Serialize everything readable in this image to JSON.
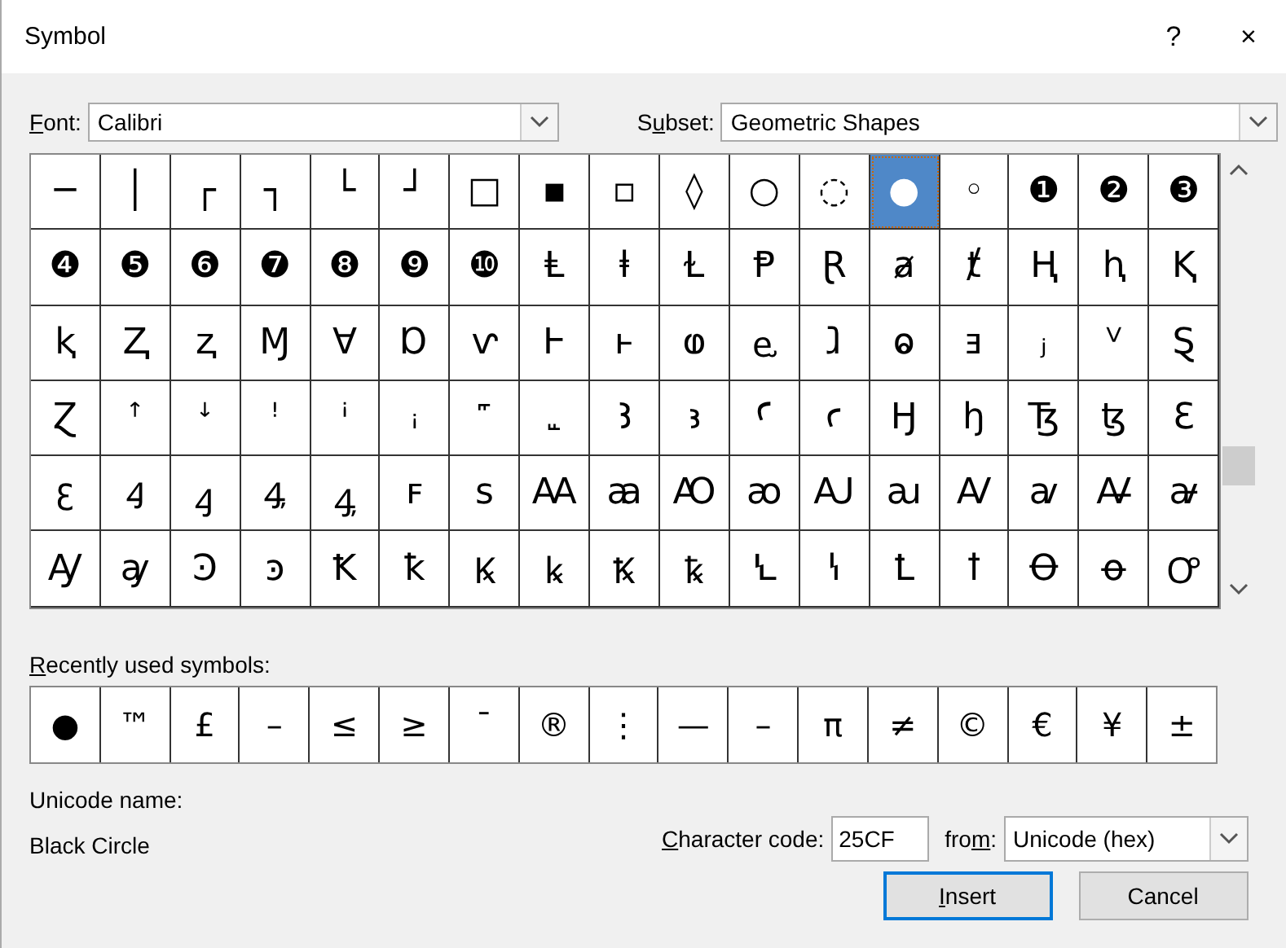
{
  "window": {
    "title": "Symbol",
    "help": "?",
    "close": "×"
  },
  "font": {
    "label": {
      "key": "F",
      "after": "ont:"
    },
    "value": "Calibri"
  },
  "subset": {
    "label": {
      "before": "S",
      "key": "u",
      "after": "bset:"
    },
    "value": "Geometric Shapes"
  },
  "grid": {
    "rows": [
      [
        {
          "char": "─",
          "selected": false
        },
        {
          "char": "│",
          "selected": false
        },
        {
          "char": "┌",
          "selected": false
        },
        {
          "char": "┐",
          "selected": false
        },
        {
          "char": "└",
          "selected": false
        },
        {
          "char": "┘",
          "selected": false
        },
        {
          "char": "□",
          "selected": false
        },
        {
          "char": "▪",
          "selected": false
        },
        {
          "char": "▫",
          "selected": false
        },
        {
          "char": "◊",
          "selected": false
        },
        {
          "char": "○",
          "selected": false
        },
        {
          "char": "◌",
          "selected": false
        },
        {
          "char": "●",
          "selected": true
        },
        {
          "char": "◦",
          "selected": false
        },
        {
          "char": "❶",
          "selected": false
        },
        {
          "char": "❷",
          "selected": false
        },
        {
          "char": "❸",
          "selected": false
        }
      ],
      [
        {
          "char": "❹",
          "selected": false
        },
        {
          "char": "❺",
          "selected": false
        },
        {
          "char": "❻",
          "selected": false
        },
        {
          "char": "❼",
          "selected": false
        },
        {
          "char": "❽",
          "selected": false
        },
        {
          "char": "❾",
          "selected": false
        },
        {
          "char": "❿",
          "selected": false
        },
        {
          "char": "Ⱡ",
          "selected": false
        },
        {
          "char": "ⱡ",
          "selected": false
        },
        {
          "char": "Ɫ",
          "selected": false
        },
        {
          "char": "Ᵽ",
          "selected": false
        },
        {
          "char": "Ɽ",
          "selected": false
        },
        {
          "char": "ⱥ",
          "selected": false
        },
        {
          "char": "ⱦ",
          "selected": false
        },
        {
          "char": "Ⱨ",
          "selected": false
        },
        {
          "char": "ⱨ",
          "selected": false
        },
        {
          "char": "Ⱪ",
          "selected": false
        }
      ],
      [
        {
          "char": "ⱪ",
          "selected": false
        },
        {
          "char": "Ⱬ",
          "selected": false
        },
        {
          "char": "ⱬ",
          "selected": false
        },
        {
          "char": "Ɱ",
          "selected": false
        },
        {
          "char": "Ɐ",
          "selected": false
        },
        {
          "char": "Ɒ",
          "selected": false
        },
        {
          "char": "ⱱ",
          "selected": false
        },
        {
          "char": "Ⱶ",
          "selected": false
        },
        {
          "char": "ⱶ",
          "selected": false
        },
        {
          "char": "ⱷ",
          "selected": false
        },
        {
          "char": "ⱸ",
          "selected": false
        },
        {
          "char": "ⱹ",
          "selected": false
        },
        {
          "char": "ⱺ",
          "selected": false
        },
        {
          "char": "ⱻ",
          "selected": false
        },
        {
          "char": "ⱼ",
          "selected": false
        },
        {
          "char": "ⱽ",
          "selected": false
        },
        {
          "char": "Ȿ",
          "selected": false
        }
      ],
      [
        {
          "char": "Ɀ",
          "selected": false
        },
        {
          "char": "ꜛ",
          "selected": false
        },
        {
          "char": "ꜜ",
          "selected": false
        },
        {
          "char": "ꜝ",
          "selected": false
        },
        {
          "char": "ꜞ",
          "selected": false
        },
        {
          "char": "ꜟ",
          "selected": false
        },
        {
          "char": "꜠",
          "selected": false
        },
        {
          "char": "꜡",
          "selected": false
        },
        {
          "char": "Ꜣ",
          "selected": false
        },
        {
          "char": "ꜣ",
          "selected": false
        },
        {
          "char": "Ꜥ",
          "selected": false
        },
        {
          "char": "ꜥ",
          "selected": false
        },
        {
          "char": "Ꜧ",
          "selected": false
        },
        {
          "char": "ꜧ",
          "selected": false
        },
        {
          "char": "Ꜩ",
          "selected": false
        },
        {
          "char": "ꜩ",
          "selected": false
        },
        {
          "char": "Ꜫ",
          "selected": false
        }
      ],
      [
        {
          "char": "ꜫ",
          "selected": false
        },
        {
          "char": "Ꜭ",
          "selected": false
        },
        {
          "char": "ꜭ",
          "selected": false
        },
        {
          "char": "Ꜯ",
          "selected": false
        },
        {
          "char": "ꜯ",
          "selected": false
        },
        {
          "char": "ꜰ",
          "selected": false
        },
        {
          "char": "ꜱ",
          "selected": false
        },
        {
          "char": "Ꜳ",
          "selected": false
        },
        {
          "char": "ꜳ",
          "selected": false
        },
        {
          "char": "Ꜵ",
          "selected": false
        },
        {
          "char": "ꜵ",
          "selected": false
        },
        {
          "char": "Ꜷ",
          "selected": false
        },
        {
          "char": "ꜷ",
          "selected": false
        },
        {
          "char": "Ꜹ",
          "selected": false
        },
        {
          "char": "ꜹ",
          "selected": false
        },
        {
          "char": "Ꜻ",
          "selected": false
        },
        {
          "char": "ꜻ",
          "selected": false
        }
      ],
      [
        {
          "char": "Ꜽ",
          "selected": false
        },
        {
          "char": "ꜽ",
          "selected": false
        },
        {
          "char": "Ꜿ",
          "selected": false
        },
        {
          "char": "ꜿ",
          "selected": false
        },
        {
          "char": "Ꝁ",
          "selected": false
        },
        {
          "char": "ꝁ",
          "selected": false
        },
        {
          "char": "Ꝃ",
          "selected": false
        },
        {
          "char": "ꝃ",
          "selected": false
        },
        {
          "char": "Ꝅ",
          "selected": false
        },
        {
          "char": "ꝅ",
          "selected": false
        },
        {
          "char": "Ꝇ",
          "selected": false
        },
        {
          "char": "ꝇ",
          "selected": false
        },
        {
          "char": "Ꝉ",
          "selected": false
        },
        {
          "char": "ꝉ",
          "selected": false
        },
        {
          "char": "Ꝋ",
          "selected": false
        },
        {
          "char": "ꝋ",
          "selected": false
        },
        {
          "char": "Ꝍ",
          "selected": false
        }
      ]
    ]
  },
  "recent": {
    "label": {
      "key": "R",
      "after": "ecently used symbols:"
    },
    "symbols": [
      "●",
      "™",
      "£",
      "–",
      "≤",
      "≥",
      "¯",
      "®",
      "⋮",
      "—",
      "–",
      "π",
      "≠",
      "©",
      "€",
      "¥",
      "±"
    ]
  },
  "unicode_name": {
    "label": "Unicode name:",
    "value": "Black Circle"
  },
  "character_code": {
    "label": {
      "key": "C",
      "after": "haracter code:"
    },
    "value": "25CF"
  },
  "from": {
    "label": {
      "before": "fro",
      "key": "m",
      "after": ":"
    },
    "value": "Unicode (hex)"
  },
  "buttons": [
    {
      "label": {
        "key": "I",
        "after": "nsert"
      },
      "default": true
    },
    {
      "label": {
        "before": "Cancel"
      },
      "default": false
    }
  ]
}
